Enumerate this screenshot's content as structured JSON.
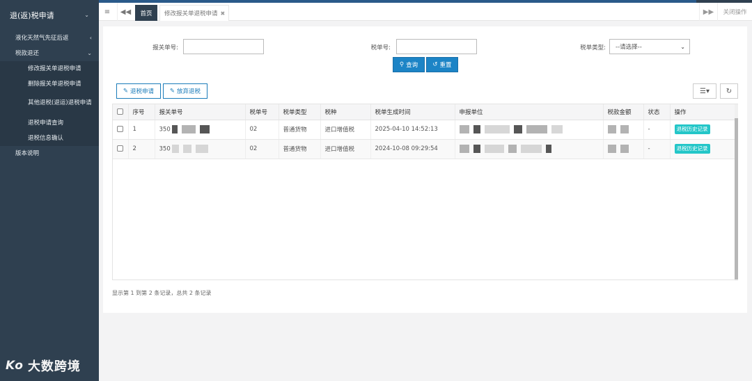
{
  "sidebar": {
    "title": "退(返)税申请",
    "items": [
      {
        "label": "液化天然气先征后返"
      },
      {
        "label": "税款退还"
      },
      {
        "label": "版本说明"
      }
    ],
    "sub_items": [
      {
        "label": "修改报关单退税申请"
      },
      {
        "label": "删除报关单退税申请"
      },
      {
        "label": "其他退税(退运)退税申请"
      },
      {
        "label": "退税申请查询"
      },
      {
        "label": "退税信息确认"
      }
    ]
  },
  "tabbar": {
    "home_label": "首页",
    "current_tab_label": "修改报关单退税申请",
    "close_ops_label": "关闭操作"
  },
  "search": {
    "customs_no_label": "报关单号:",
    "tax_no_label": "税单号:",
    "tax_type_label": "税单类型:",
    "tax_type_selected": "--请选择--",
    "query_label": "查询",
    "reset_label": "重置"
  },
  "toolbar": {
    "apply_label": "退税申请",
    "abandon_label": "放弃退税"
  },
  "table": {
    "headers": [
      "序号",
      "报关单号",
      "税单号",
      "税单类型",
      "税种",
      "税单生成时间",
      "申报单位",
      "税款金额",
      "状态",
      "操作"
    ],
    "rows": [
      {
        "index": "1",
        "customs_no": "350",
        "tax_no": "02",
        "tax_type": "普通货物",
        "tax_kind": "进口增值税",
        "time": "2025-04-10 14:52:13",
        "status": "-",
        "action": "退税历史记录"
      },
      {
        "index": "2",
        "customs_no": "350",
        "tax_no": "02",
        "tax_type": "普通货物",
        "tax_kind": "进口增值税",
        "time": "2024-10-08 09:29:54",
        "status": "-",
        "action": "退税历史记录"
      }
    ]
  },
  "footer": {
    "summary": "显示第 1 到第 2 条记录，总共 2 条记录"
  },
  "watermark": {
    "text": "大数跨境",
    "logo": "Ko"
  },
  "colors": {
    "sidebar_bg": "#2f4050",
    "primary": "#1c84c6",
    "history_btn": "#23c6c8"
  }
}
